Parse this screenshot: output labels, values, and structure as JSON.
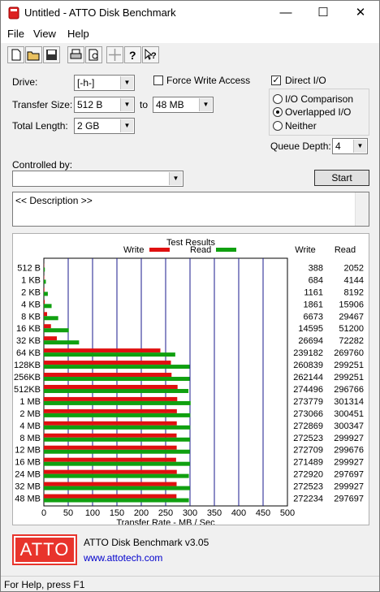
{
  "window": {
    "title": "Untitled - ATTO Disk Benchmark",
    "minimize_glyph": "—",
    "maximize_glyph": "☐",
    "close_glyph": "✕"
  },
  "menu": [
    "File",
    "View",
    "Help"
  ],
  "toolbar_icons": [
    "new-file-icon",
    "open-folder-icon",
    "save-icon",
    "print-icon",
    "print-preview-icon",
    "move-icon",
    "help-icon",
    "context-help-icon"
  ],
  "form": {
    "drive_label": "Drive:",
    "drive_value": "[-h-]",
    "force_write_label": "Force Write Access",
    "direct_io_label": "Direct I/O",
    "transfer_size_label": "Transfer Size:",
    "transfer_from": "512 B",
    "to_label": "to",
    "transfer_to": "48 MB",
    "total_length_label": "Total Length:",
    "total_length_value": "2 GB",
    "io_comparison_label": "I/O Comparison",
    "overlapped_io_label": "Overlapped I/O",
    "neither_label": "Neither",
    "queue_depth_label": "Queue Depth:",
    "queue_depth_value": "4",
    "controlled_by_label": "Controlled by:",
    "controlled_by_value": "",
    "start_label": "Start",
    "description": "<< Description >>"
  },
  "results": {
    "title": "Test Results",
    "write_header": "Write",
    "read_header": "Read",
    "rows": [
      {
        "size": "512 B",
        "write": "388",
        "read": "2052"
      },
      {
        "size": "1 KB",
        "write": "684",
        "read": "4144"
      },
      {
        "size": "2 KB",
        "write": "1161",
        "read": "8192"
      },
      {
        "size": "4 KB",
        "write": "1861",
        "read": "15906"
      },
      {
        "size": "8 KB",
        "write": "6673",
        "read": "29467"
      },
      {
        "size": "16 KB",
        "write": "14595",
        "read": "51200"
      },
      {
        "size": "32 KB",
        "write": "26694",
        "read": "72282"
      },
      {
        "size": "64 KB",
        "write": "239182",
        "read": "269760"
      },
      {
        "size": "128KB",
        "write": "260839",
        "read": "299251"
      },
      {
        "size": "256KB",
        "write": "262144",
        "read": "299251"
      },
      {
        "size": "512KB",
        "write": "274496",
        "read": "296766"
      },
      {
        "size": "1 MB",
        "write": "273779",
        "read": "301314"
      },
      {
        "size": "2 MB",
        "write": "273066",
        "read": "300451"
      },
      {
        "size": "4 MB",
        "write": "272869",
        "read": "300347"
      },
      {
        "size": "8 MB",
        "write": "272523",
        "read": "299927"
      },
      {
        "size": "12 MB",
        "write": "272709",
        "read": "299676"
      },
      {
        "size": "16 MB",
        "write": "271489",
        "read": "299927"
      },
      {
        "size": "24 MB",
        "write": "272920",
        "read": "297697"
      },
      {
        "size": "32 MB",
        "write": "272523",
        "read": "299927"
      },
      {
        "size": "48 MB",
        "write": "272234",
        "read": "297697"
      }
    ]
  },
  "chart_data": {
    "type": "bar",
    "orientation": "horizontal",
    "categories": [
      "512 B",
      "1 KB",
      "2 KB",
      "4 KB",
      "8 KB",
      "16 KB",
      "32 KB",
      "64 KB",
      "128KB",
      "256KB",
      "512KB",
      "1 MB",
      "2 MB",
      "4 MB",
      "8 MB",
      "12 MB",
      "16 MB",
      "24 MB",
      "32 MB",
      "48 MB"
    ],
    "series": [
      {
        "name": "Write",
        "color": "#e01010",
        "values": [
          0.388,
          0.684,
          1.161,
          1.861,
          6.673,
          14.595,
          26.694,
          239.182,
          260.839,
          262.144,
          274.496,
          273.779,
          273.066,
          272.869,
          272.523,
          272.709,
          271.489,
          272.92,
          272.523,
          272.234
        ]
      },
      {
        "name": "Read",
        "color": "#10a010",
        "values": [
          2.052,
          4.144,
          8.192,
          15.906,
          29.467,
          51.2,
          72.282,
          269.76,
          299.251,
          299.251,
          296.766,
          301.314,
          300.451,
          300.347,
          299.927,
          299.676,
          299.927,
          297.697,
          299.927,
          297.697
        ]
      }
    ],
    "xlabel": "Transfer Rate - MB / Sec",
    "xlim": [
      0,
      500
    ],
    "xticks": [
      0,
      50,
      100,
      150,
      200,
      250,
      300,
      350,
      400,
      450,
      500
    ],
    "grid": true,
    "legend": "top"
  },
  "footer": {
    "logo_text": "ATTO",
    "product": "ATTO Disk Benchmark v3.05",
    "link": "www.attotech.com"
  },
  "status": "For Help, press F1",
  "colors": {
    "accent": "#e8342c",
    "link": "#0000cc",
    "grid": "#1a1a8c"
  }
}
